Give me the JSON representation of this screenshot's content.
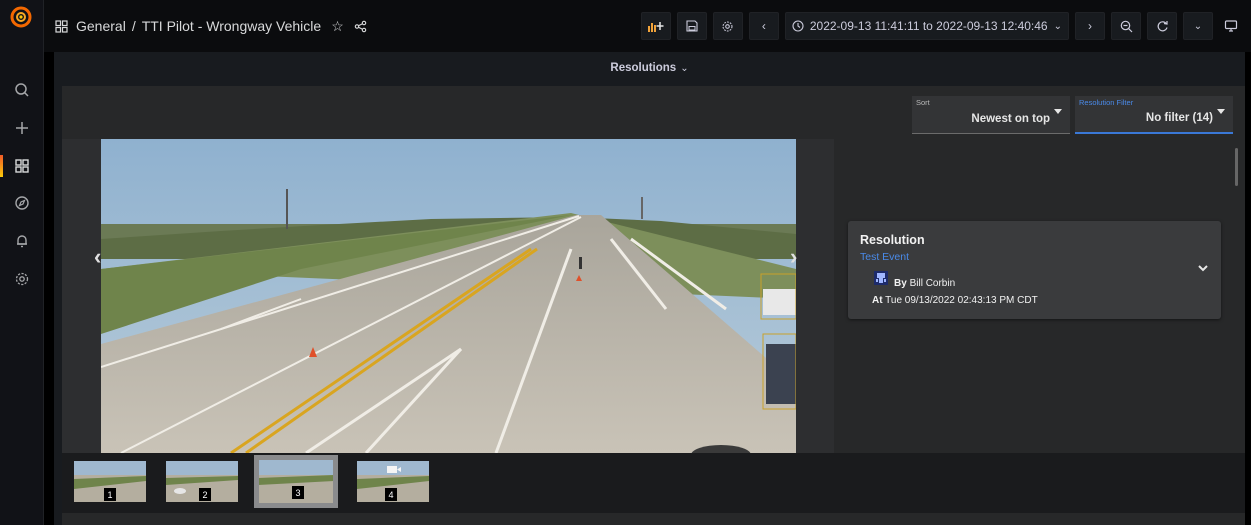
{
  "breadcrumb": {
    "folder": "General",
    "separator": "/",
    "dashboard": "TTI Pilot - Wrongway Vehicle"
  },
  "time_range": {
    "label": "2022-09-13 11:41:11 to 2022-09-13 12:40:46"
  },
  "sidebar": {
    "items": [
      {
        "name": "search",
        "icon": "search-icon"
      },
      {
        "name": "create",
        "icon": "plus-icon"
      },
      {
        "name": "dashboards",
        "icon": "dashboards-icon",
        "active": true
      },
      {
        "name": "explore",
        "icon": "compass-icon"
      },
      {
        "name": "alerting",
        "icon": "bell-icon"
      },
      {
        "name": "configuration",
        "icon": "gear-icon"
      }
    ]
  },
  "panel": {
    "title": "Resolutions"
  },
  "sort": {
    "label": "Sort",
    "value": "Newest on top"
  },
  "filter": {
    "label": "Resolution Filter",
    "value": "No filter (14)"
  },
  "resolution": {
    "title": "Resolution",
    "event": "Test Event",
    "by_prefix": "By",
    "by_name": "Bill Corbin",
    "at_prefix": "At",
    "at_value": "Tue 09/13/2022 02:43:13 PM CDT"
  },
  "thumbnails": [
    "1",
    "2",
    "3",
    "4"
  ],
  "selected_thumbnail": 3,
  "colors": {
    "accent": "#3a78d6",
    "brand_orange": "#f05a28",
    "link_blue": "#4a8ae8"
  }
}
